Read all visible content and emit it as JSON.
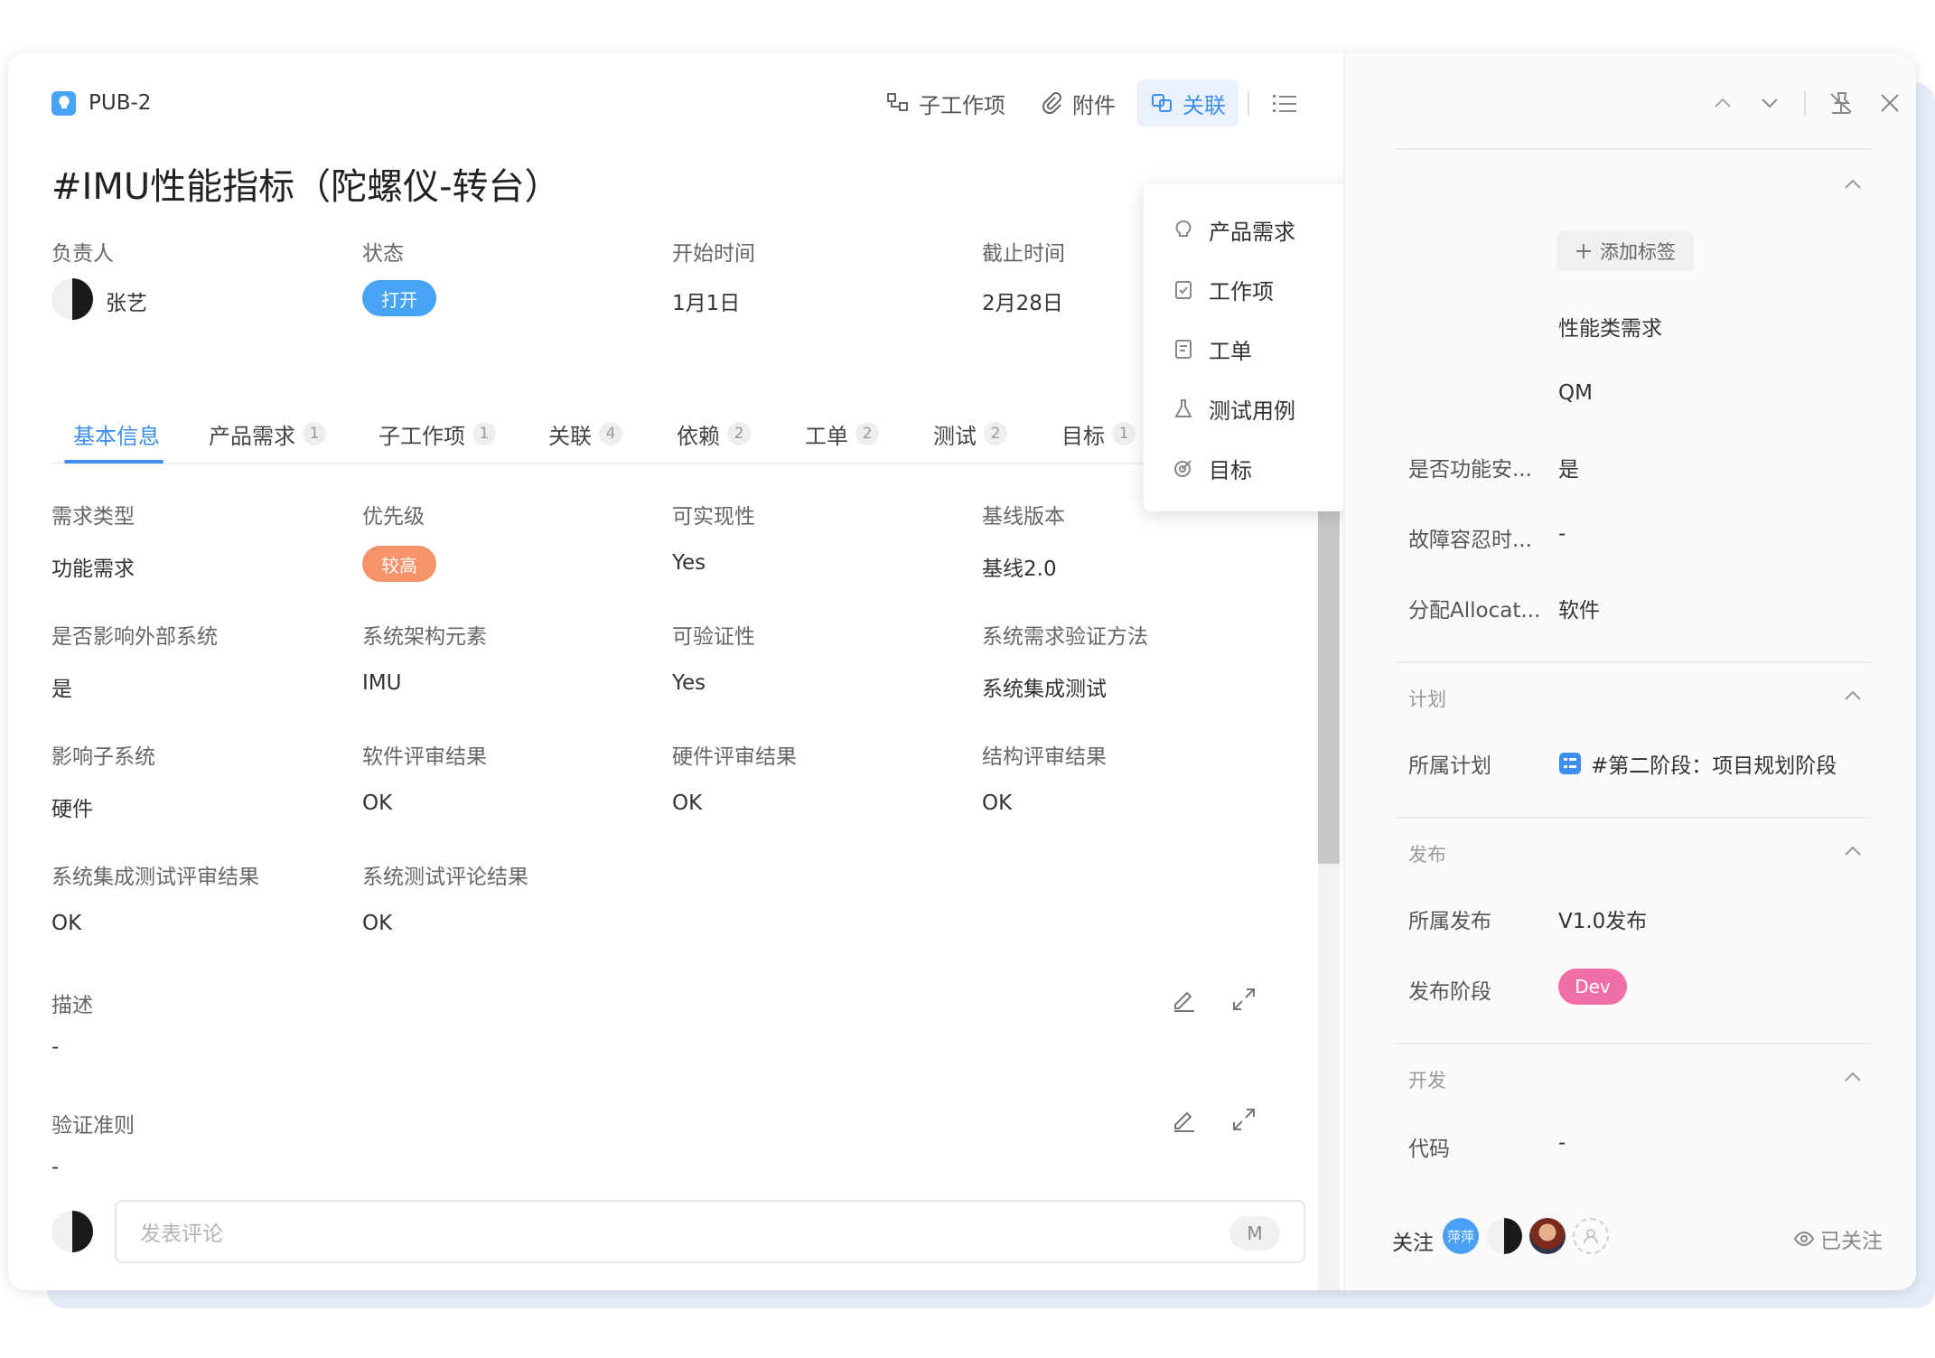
{
  "header": {
    "id": "PUB-2",
    "toolbar": {
      "subitems_label": "子工作项",
      "attachments_label": "附件",
      "links_label": "关联"
    }
  },
  "title": "#IMU性能指标（陀螺仪-转台）",
  "basic": {
    "owner_label": "负责人",
    "owner_value": "张艺",
    "status_label": "状态",
    "status_value": "打开",
    "start_label": "开始时间",
    "start_value": "1月1日",
    "due_label": "截止时间",
    "due_value": "2月28日"
  },
  "tabs": [
    {
      "label": "基本信息",
      "count": ""
    },
    {
      "label": "产品需求",
      "count": "1"
    },
    {
      "label": "子工作项",
      "count": "1"
    },
    {
      "label": "关联",
      "count": "4"
    },
    {
      "label": "依赖",
      "count": "2"
    },
    {
      "label": "工单",
      "count": "2"
    },
    {
      "label": "测试",
      "count": "2"
    },
    {
      "label": "目标",
      "count": "1"
    }
  ],
  "fields": [
    {
      "label": "需求类型",
      "value": "功能需求"
    },
    {
      "label": "优先级",
      "value": "较高"
    },
    {
      "label": "可实现性",
      "value": "Yes"
    },
    {
      "label": "基线版本",
      "value": "基线2.0"
    },
    {
      "label": "是否影响外部系统",
      "value": "是"
    },
    {
      "label": "系统架构元素",
      "value": "IMU"
    },
    {
      "label": "可验证性",
      "value": "Yes"
    },
    {
      "label": "系统需求验证方法",
      "value": "系统集成测试"
    },
    {
      "label": "影响子系统",
      "value": "硬件"
    },
    {
      "label": "软件评审结果",
      "value": "OK"
    },
    {
      "label": "硬件评审结果",
      "value": "OK"
    },
    {
      "label": "结构评审结果",
      "value": "OK"
    },
    {
      "label": "系统集成测试评审结果",
      "value": "OK"
    },
    {
      "label": "系统测试评论结果",
      "value": "OK"
    }
  ],
  "description": {
    "label": "描述",
    "value": "-"
  },
  "acceptance": {
    "label": "验证准则",
    "value": "-"
  },
  "comment": {
    "placeholder": "发表评论",
    "m_label": "M"
  },
  "dropdown": {
    "items": [
      "产品需求",
      "工作项",
      "工单",
      "测试用例",
      "目标"
    ]
  },
  "side": {
    "add_tag": "添加标签",
    "rows_top": [
      {
        "label": "",
        "value": "性能类需求"
      },
      {
        "label": "",
        "value": "QM"
      },
      {
        "label": "是否功能安...",
        "value": "是"
      },
      {
        "label": "故障容忍时...",
        "value": "-"
      },
      {
        "label": "分配Allocat...",
        "value": "软件"
      }
    ],
    "plan": {
      "title": "计划",
      "label": "所属计划",
      "value": "#第二阶段：项目规划阶段"
    },
    "release": {
      "title": "发布",
      "label": "所属发布",
      "value": "V1.0发布",
      "stage_label": "发布阶段",
      "stage_value": "Dev"
    },
    "dev": {
      "title": "开发",
      "label": "代码",
      "value": "-"
    },
    "follow": {
      "label": "关注",
      "avatar_text": "萍萍",
      "followed": "已关注"
    }
  },
  "colors": {
    "accent": "#3d8ef0",
    "status_pill": "#47a3f3",
    "priority_pill": "#f6936b",
    "dev_pill": "#f06fa8"
  }
}
